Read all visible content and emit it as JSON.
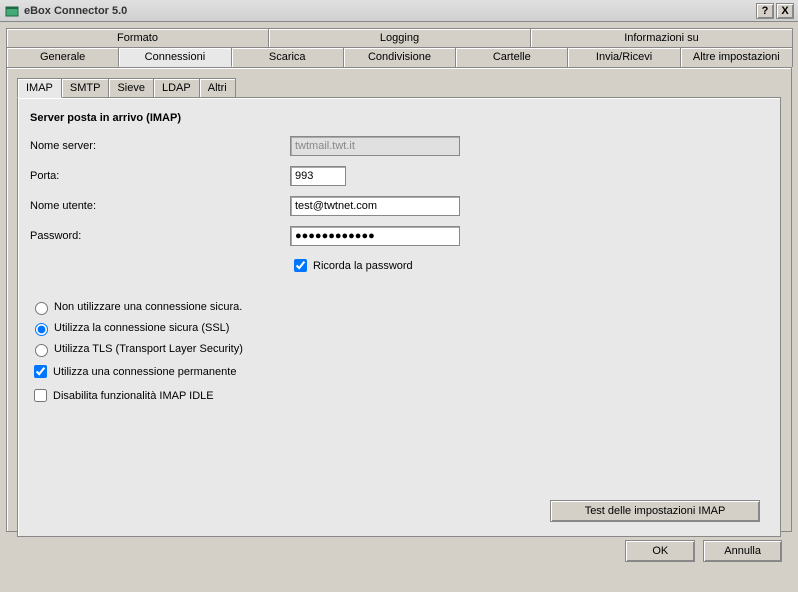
{
  "window": {
    "title": "eBox Connector 5.0",
    "help_symbol": "?",
    "close_symbol": "X"
  },
  "tabs_row1": {
    "formato": "Formato",
    "logging": "Logging",
    "info": "Informazioni su"
  },
  "tabs_row2": {
    "generale": "Generale",
    "connessioni": "Connessioni",
    "scarica": "Scarica",
    "condivisione": "Condivisione",
    "cartelle": "Cartelle",
    "invia_ricevi": "Invia/Ricevi",
    "altre": "Altre impostazioni"
  },
  "subtabs": {
    "imap": "IMAP",
    "smtp": "SMTP",
    "sieve": "Sieve",
    "ldap": "LDAP",
    "altri": "Altri"
  },
  "section": {
    "title": "Server posta in arrivo (IMAP)"
  },
  "fields": {
    "server_label": "Nome server:",
    "server_value": "twtmail.twt.it",
    "port_label": "Porta:",
    "port_value": "993",
    "user_label": "Nome utente:",
    "user_value": "test@twtnet.com",
    "password_label": "Password:",
    "password_value": "●●●●●●●●●●●●"
  },
  "checks": {
    "remember_password": "Ricorda la password"
  },
  "radios": {
    "no_secure": "Non utilizzare una connessione sicura.",
    "ssl": "Utilizza la connessione sicura (SSL)",
    "tls": "Utilizza TLS (Transport Layer Security)"
  },
  "options": {
    "persistent": "Utilizza una connessione permanente",
    "disable_idle": "Disabilita funzionalità IMAP IDLE"
  },
  "buttons": {
    "test": "Test delle impostazioni IMAP",
    "ok": "OK",
    "cancel": "Annulla"
  }
}
